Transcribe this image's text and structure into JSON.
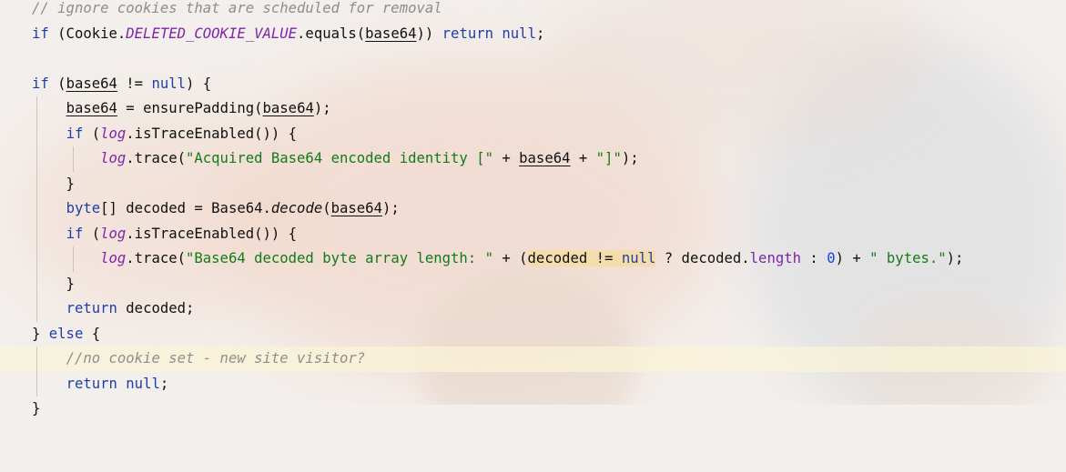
{
  "editor": {
    "language": "java",
    "colors": {
      "keyword": "#1f3ea8",
      "string": "#137b18",
      "comment": "#8e8e8e",
      "field": "#7e24a8",
      "number": "#1740f0",
      "text": "#101010",
      "highlight_line": "#faf4d6",
      "match_highlight": "#f5dcab"
    },
    "lines": {
      "l1": {
        "c": "// ignore cookies that are scheduled for removal"
      },
      "l2": {
        "a": "if",
        "b": " (Cookie.",
        "c": "DELETED_COOKIE_VALUE",
        "d": ".equals(",
        "e": "base64",
        "f": ")) ",
        "g": "return",
        "h": " ",
        "i": "null",
        "j": ";"
      },
      "l3": {},
      "l4": {
        "a": "if",
        "b": " (",
        "c": "base64",
        "d": " != ",
        "e": "null",
        "f": ") {"
      },
      "l5": {
        "a": "    ",
        "b": "base64",
        "c": " = ensurePadding(",
        "d": "base64",
        "e": ");"
      },
      "l6": {
        "a": "    ",
        "b": "if",
        "c": " (",
        "d": "log",
        "e": ".isTraceEnabled()) {"
      },
      "l7": {
        "a": "        ",
        "b": "log",
        "c": ".trace(",
        "d": "\"Acquired Base64 encoded identity [\"",
        "e": " + ",
        "f": "base64",
        "g": " + ",
        "h": "\"]\"",
        "i": ");"
      },
      "l8": {
        "a": "    }"
      },
      "l9": {
        "a": "    ",
        "b": "byte",
        "c": "[] decoded = Base64.",
        "d": "decode",
        "e": "(",
        "f": "base64",
        "g": ");"
      },
      "l10": {
        "a": "    ",
        "b": "if",
        "c": " (",
        "d": "log",
        "e": ".isTraceEnabled()) {"
      },
      "l11": {
        "a": "        ",
        "b": "log",
        "c": ".trace(",
        "d": "\"Base64 decoded byte array length: \"",
        "e": " + (",
        "f": "decoded != ",
        "g": "null",
        "h": " ? decoded.",
        "i": "length",
        "j": " : ",
        "k": "0",
        "l": ") + ",
        "m": "\" bytes.\"",
        "n": ");"
      },
      "l12": {
        "a": "    }"
      },
      "l13": {
        "a": "    ",
        "b": "return",
        "c": " decoded;"
      },
      "l14": {
        "a": "} ",
        "b": "else",
        "c": " {"
      },
      "l15": {
        "a": "    ",
        "b": "//no cookie set - new site visitor?"
      },
      "l16": {
        "a": "    ",
        "b": "return",
        "c": " ",
        "d": "null",
        "e": ";"
      },
      "l17": {
        "a": "}"
      }
    }
  }
}
